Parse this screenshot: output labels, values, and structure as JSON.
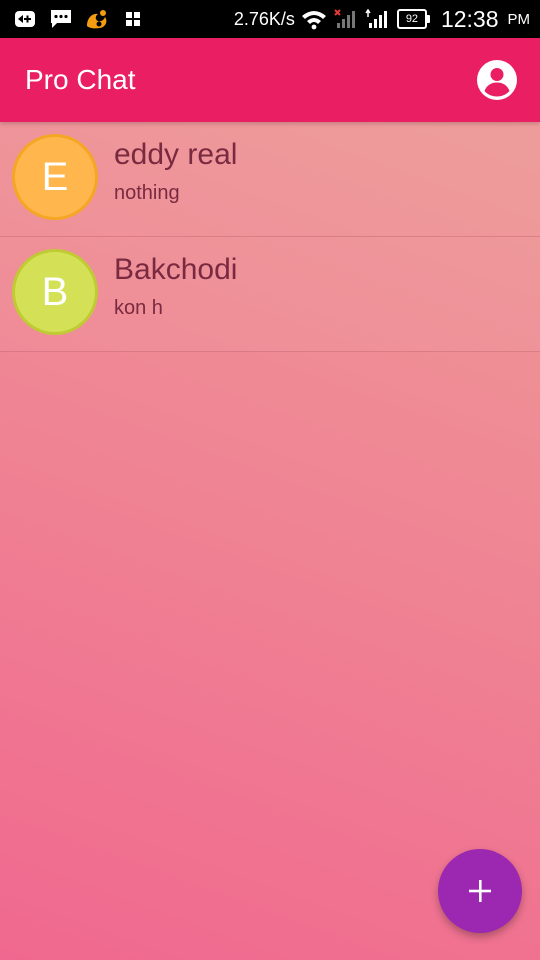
{
  "status_bar": {
    "net_speed": "2.76K/s",
    "battery_level": "92",
    "time": "12:38",
    "ampm": "PM",
    "icons": [
      "usb-debug-icon",
      "messages-icon",
      "uc-browser-icon",
      "apps-grid-icon",
      "wifi-icon",
      "signal-icon-sim1",
      "signal-icon-sim2",
      "battery-icon"
    ]
  },
  "app_bar": {
    "title": "Pro Chat",
    "profile_icon": "account-circle-icon"
  },
  "chats": [
    {
      "initial": "E",
      "name": "eddy real",
      "last_message": "nothing",
      "avatar_color": "#ffb74d",
      "avatar_border": "#f5a623"
    },
    {
      "initial": "B",
      "name": "Bakchodi",
      "last_message": "kon h",
      "avatar_color": "#d4e157",
      "avatar_border": "#c0ca33"
    }
  ],
  "fab": {
    "icon": "plus-icon",
    "color": "#9c27b0"
  },
  "colors": {
    "app_bar": "#e91e63",
    "text_dark": "#7a2a40"
  }
}
